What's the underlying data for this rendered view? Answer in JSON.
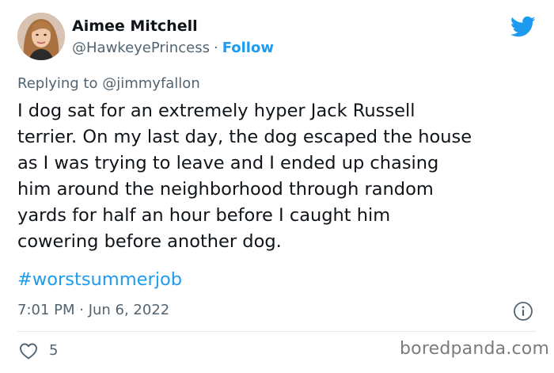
{
  "author": {
    "display_name": "Aimee Mitchell",
    "handle": "@HawkeyePrincess",
    "separator": "·",
    "follow_label": "Follow"
  },
  "reply": {
    "prefix": "Replying to",
    "mention": "@jimmyfallon"
  },
  "body": {
    "lines": [
      "I dog sat for an extremely hyper Jack Russell",
      "terrier. On my last day, the dog escaped the house",
      "as I was trying to leave and I ended up chasing",
      "him around the neighborhood through random",
      "yards for half an hour before I caught him",
      "cowering before another dog."
    ],
    "hashtag": "#worstsummerjob"
  },
  "meta": {
    "timestamp": "7:01 PM · Jun 6, 2022"
  },
  "actions": {
    "like_count": "5"
  },
  "watermark": "boredpanda.com",
  "icons": {
    "brand": "twitter-bird-icon",
    "info": "info-icon",
    "like": "heart-icon"
  },
  "colors": {
    "accent": "#1d9bf0",
    "text": "#0f1419",
    "secondary": "#536471",
    "divider": "#e7e9ea"
  }
}
